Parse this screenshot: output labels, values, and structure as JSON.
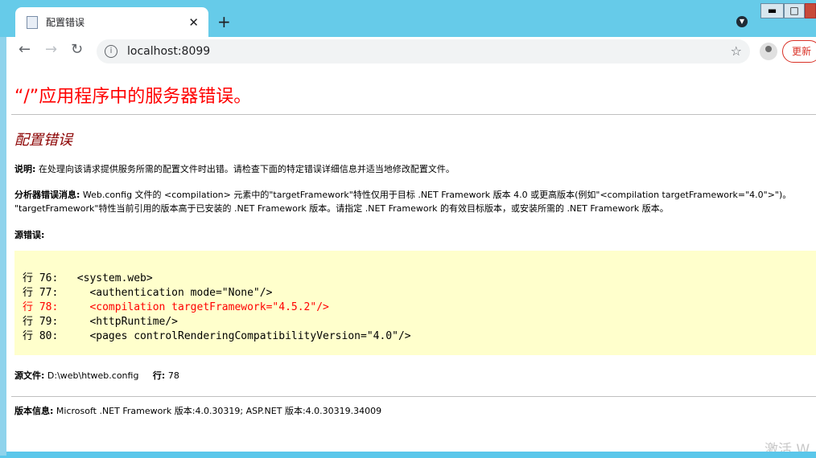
{
  "browser": {
    "tab_title": "配置错误",
    "tab_close": "✕",
    "new_tab": "+",
    "url": "localhost:8099",
    "update_label": "更新",
    "window_min": "▬",
    "window_max": "□",
    "window_close": "✕"
  },
  "page": {
    "error_title": "“/”应用程序中的服务器错误。",
    "sub_title": "配置错误",
    "desc_label": "说明:",
    "desc_text": "在处理向该请求提供服务所需的配置文件时出错。请检查下面的特定错误详细信息并适当地修改配置文件。",
    "parser_label": "分析器错误消息:",
    "parser_line1": "Web.config 文件的 <compilation> 元素中的\"targetFramework\"特性仅用于目标 .NET Framework 版本 4.0 或更高版本(例如\"<compilation targetFramework=\"4.0\">\")。",
    "parser_line2": "\"targetFramework\"特性当前引用的版本高于已安装的 .NET Framework 版本。请指定 .NET Framework 的有效目标版本，或安装所需的 .NET Framework 版本。",
    "source_error_label": "源错误:",
    "code_lines": [
      "行 76:   <system.web>",
      "行 77:     <authentication mode=\"None\"/>",
      "行 78:     <compilation targetFramework=\"4.5.2\"/>",
      "行 79:     <httpRuntime/>",
      "行 80:     <pages controlRenderingCompatibilityVersion=\"4.0\"/>"
    ],
    "source_file_label": "源文件:",
    "source_file_value": "D:\\web\\htweb.config",
    "line_label": "行:",
    "line_value": "78",
    "version_label": "版本信息:",
    "version_text": "Microsoft .NET Framework 版本:4.0.30319; ASP.NET 版本:4.0.30319.34009"
  },
  "watermark": "激活 W",
  "colors": {
    "error_title": "#ff0000",
    "sub_title": "#8b0000",
    "code_bg": "#ffffcc",
    "titlebar": "#66cbe9"
  }
}
